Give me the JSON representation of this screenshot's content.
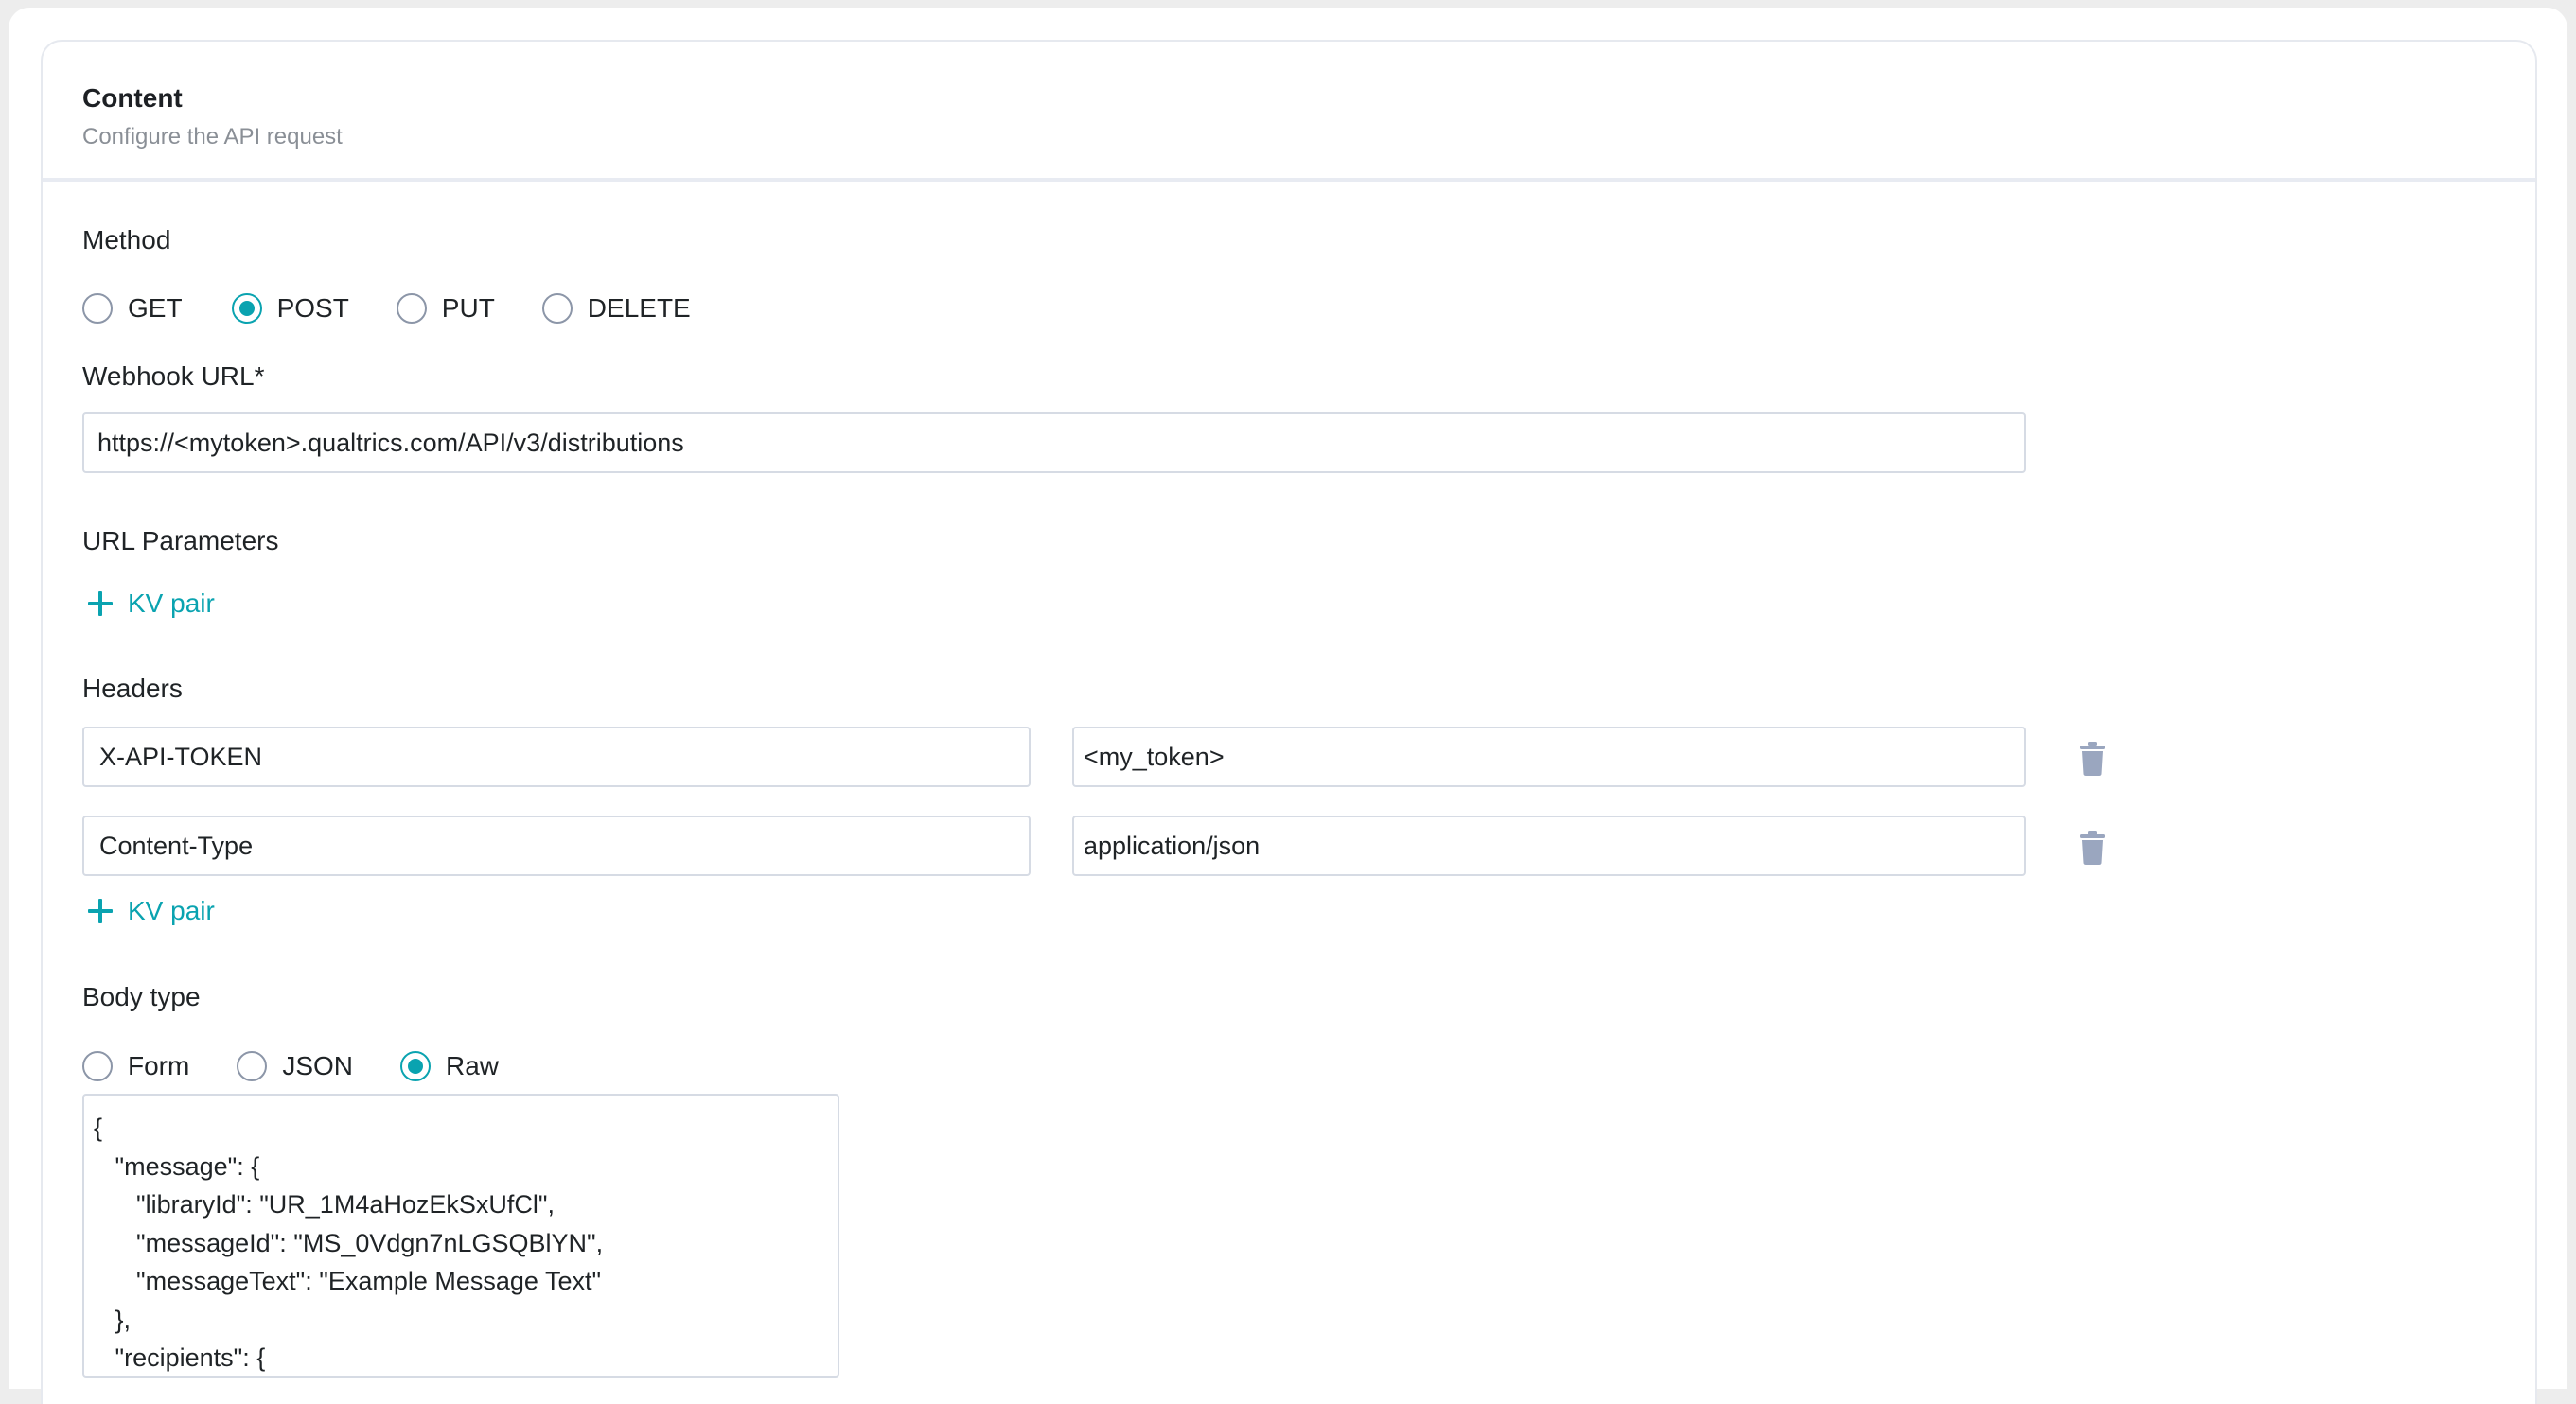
{
  "section": {
    "title": "Content",
    "subtitle": "Configure the API request"
  },
  "method": {
    "label": "Method",
    "options": [
      {
        "label": "GET",
        "checked": false
      },
      {
        "label": "POST",
        "checked": true
      },
      {
        "label": "PUT",
        "checked": false
      },
      {
        "label": "DELETE",
        "checked": false
      }
    ]
  },
  "webhook": {
    "label": "Webhook URL*",
    "value": "https://<mytoken>.qualtrics.com/API/v3/distributions"
  },
  "url_parameters": {
    "label": "URL Parameters",
    "add_label": "KV pair"
  },
  "headers": {
    "label": "Headers",
    "rows": [
      {
        "key": "X-API-TOKEN",
        "value": "<my_token>"
      },
      {
        "key": "Content-Type",
        "value": "application/json"
      }
    ],
    "add_label": "KV pair"
  },
  "body_type": {
    "label": "Body type",
    "options": [
      {
        "label": "Form",
        "checked": false
      },
      {
        "label": "JSON",
        "checked": false
      },
      {
        "label": "Raw",
        "checked": true
      }
    ]
  },
  "body": {
    "value": "{\n   \"message\": {\n      \"libraryId\": \"UR_1M4aHozEkSxUfCl\",\n      \"messageId\": \"MS_0Vdgn7nLGSQBlYN\",\n      \"messageText\": \"Example Message Text\"\n   },\n   \"recipients\": {"
  },
  "colors": {
    "accent": "#0aa3b0",
    "trash": "#9aa6bf",
    "border": "#d6dbe4"
  }
}
